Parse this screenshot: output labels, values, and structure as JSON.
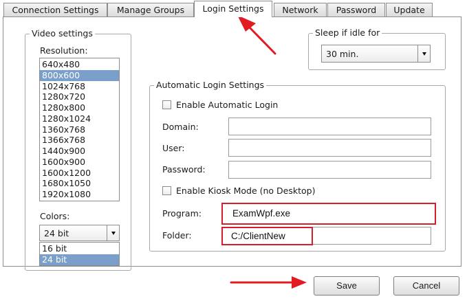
{
  "tabs": [
    {
      "label": "Connection Settings",
      "active": false
    },
    {
      "label": "Manage Groups",
      "active": false
    },
    {
      "label": "Login Settings",
      "active": true
    },
    {
      "label": "Network",
      "active": false
    },
    {
      "label": "Password",
      "active": false
    },
    {
      "label": "Update",
      "active": false
    }
  ],
  "video_settings": {
    "legend": "Video settings",
    "resolution_label": "Resolution:",
    "resolutions": [
      "640x480",
      "800x600",
      "1024x768",
      "1280x720",
      "1280x800",
      "1280x1024",
      "1360x768",
      "1366x768",
      "1440x900",
      "1600x900",
      "1600x1200",
      "1680x1050",
      "1920x1080"
    ],
    "selected_resolution": "800x600",
    "colors_label": "Colors:",
    "colors_value": "24 bit",
    "colors_options": [
      "16 bit",
      "24 bit"
    ],
    "colors_highlighted": "24 bit"
  },
  "sleep": {
    "legend": "Sleep if idle for",
    "value": "30 min."
  },
  "auto_login": {
    "legend": "Automatic Login Settings",
    "enable_label": "Enable Automatic Login",
    "enable_checked": false,
    "domain_label": "Domain:",
    "domain_value": "",
    "user_label": "User:",
    "user_value": "",
    "password_label": "Password:",
    "password_value": "",
    "kiosk_label": "Enable Kiosk Mode (no Desktop)",
    "kiosk_checked": false,
    "program_label": "Program:",
    "program_value": "ExamWpf.exe",
    "folder_label": "Folder:",
    "folder_value": "C:/ClientNew"
  },
  "buttons": {
    "save": "Save",
    "cancel": "Cancel"
  },
  "colors": {
    "highlight_red": "#d41f2a",
    "selection_blue": "#7a9fcb"
  }
}
